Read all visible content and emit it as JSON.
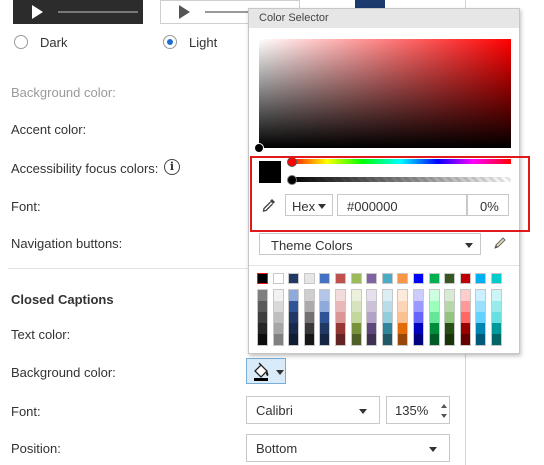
{
  "player_style": {
    "dark_label": "Dark",
    "light_label": "Light",
    "selected": "Light"
  },
  "settings": {
    "background_color_label": "Background color:",
    "accent_color_label": "Accent color:",
    "accessibility_focus_label": "Accessibility focus colors:",
    "font_label": "Font:",
    "navigation_buttons_label": "Navigation buttons:"
  },
  "closed_captions": {
    "title": "Closed Captions",
    "text_color_label": "Text color:",
    "background_color_label": "Background color:",
    "font_label": "Font:",
    "font_value": "Calibri",
    "font_size_value": "135%",
    "position_label": "Position:",
    "position_value": "Bottom"
  },
  "color_selector": {
    "title": "Color Selector",
    "current_color": "#000000",
    "format_select": "Hex",
    "hex_value": "#000000",
    "alpha_value": "0%",
    "palette_dropdown": "Theme Colors",
    "highlight_color": "#e01a1a",
    "palette_top": [
      "#000000",
      "#ffffff",
      "#1f3864",
      "#e7e6e6",
      "#4472c4",
      "#c0504d",
      "#9bbb59",
      "#8064a2",
      "#4bacc6",
      "#f79646",
      "#0000ff",
      "#00b050",
      "#375623",
      "#c00000",
      "#00b0f0",
      "#00cccc"
    ],
    "palette_shades": [
      [
        "#7f7f7f",
        "#595959",
        "#3f3f3f",
        "#262626",
        "#0d0d0d"
      ],
      [
        "#f2f2f2",
        "#d9d9d9",
        "#bfbfbf",
        "#a6a6a6",
        "#808080"
      ],
      [
        "#8ea9db",
        "#2f5597",
        "#203864",
        "#172a4b",
        "#0f1c32"
      ],
      [
        "#d0cece",
        "#aeaaaa",
        "#767171",
        "#3b3838",
        "#181717"
      ],
      [
        "#b4c6e7",
        "#8eaadb",
        "#2f5496",
        "#1f3864",
        "#142544"
      ],
      [
        "#f2dcdb",
        "#e6b9b8",
        "#d99694",
        "#953734",
        "#632423"
      ],
      [
        "#ebf1dd",
        "#d7e3bc",
        "#c3d69b",
        "#76923c",
        "#4f6128"
      ],
      [
        "#e5e0ec",
        "#ccc1d9",
        "#b2a2c7",
        "#5f497a",
        "#3f3151"
      ],
      [
        "#dbeef3",
        "#b7dde8",
        "#92cddc",
        "#31859b",
        "#205867"
      ],
      [
        "#fdeada",
        "#fbd5b5",
        "#fac08f",
        "#e36c09",
        "#974806"
      ],
      [
        "#ccccff",
        "#9999ff",
        "#6666ff",
        "#0000bf",
        "#000080"
      ],
      [
        "#ccffdd",
        "#99ffbb",
        "#66e699",
        "#008c3a",
        "#005c26"
      ],
      [
        "#d9ead3",
        "#b6d7a8",
        "#93c47d",
        "#274e13",
        "#1a3409"
      ],
      [
        "#ffcccc",
        "#ff9999",
        "#ff6666",
        "#990000",
        "#660000"
      ],
      [
        "#ccf0ff",
        "#99e0ff",
        "#66d1ff",
        "#0086b3",
        "#005a78"
      ],
      [
        "#ccf5f5",
        "#99ebeb",
        "#66e0e0",
        "#009999",
        "#006666"
      ]
    ]
  }
}
